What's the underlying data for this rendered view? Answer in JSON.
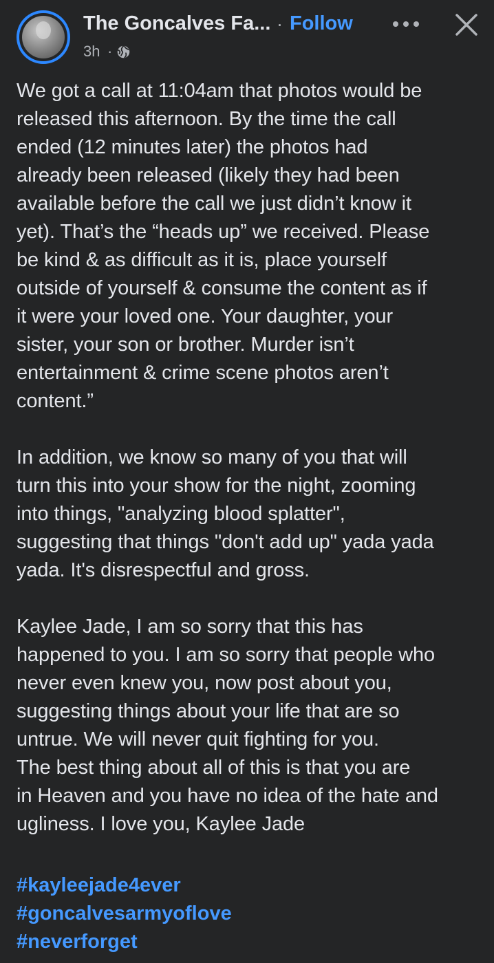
{
  "header": {
    "page_name": "The Goncalves Fa...",
    "separator": "·",
    "follow_label": "Follow",
    "timestamp": "3h",
    "time_separator": "·",
    "audience_icon": "globe-icon",
    "more_icon": "more-horizontal-icon",
    "close_icon": "close-icon",
    "accent_color": "#2d88ff"
  },
  "post": {
    "paragraphs": [
      "We got a call at 11:04am that photos would be\nreleased this afternoon. By the time the call\nended (12 minutes later) the photos had\nalready been released (likely they had been\navailable before the call we just didn’t know it\nyet). That’s the “heads up” we received. Please\nbe kind & as difficult as it is, place yourself\noutside of yourself & consume the content as if\nit were your loved one. Your daughter, your\nsister, your son or brother. Murder isn’t\nentertainment & crime scene photos aren’t\ncontent.”",
      "In addition, we know so many of you that will\nturn this into your show for the night, zooming\ninto things, \"analyzing blood splatter\",\nsuggesting that things \"don't add up\" yada yada\nyada. It's disrespectful and gross.",
      "Kaylee Jade, I am so sorry that this has\nhappened to you. I am so sorry that people who\nnever even knew you, now post about you,\nsuggesting things about your life  that are so\nuntrue. We will never quit fighting for you.\nThe best thing about all of this is that you are\nin Heaven and you have no idea of the hate and\nugliness. I love you, Kaylee Jade"
    ],
    "hashtags": [
      "#kayleejade4ever",
      "#goncalvesarmyoflove",
      "#neverforget"
    ]
  },
  "colors": {
    "background": "#242526",
    "text": "#e4e6eb",
    "secondary_text": "#b0b3b8",
    "link": "#4599ff"
  }
}
